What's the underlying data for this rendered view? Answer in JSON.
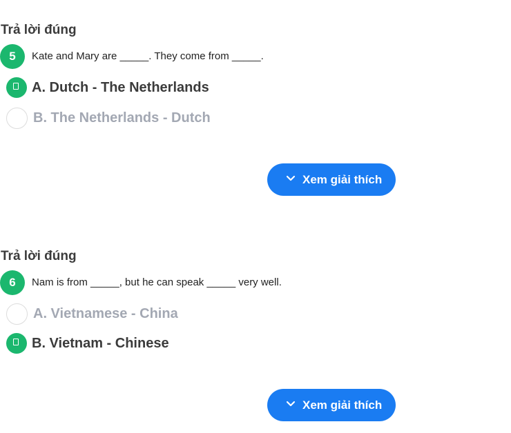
{
  "questions": [
    {
      "status": "Trả lời đúng",
      "number": "5",
      "text": "Kate and Mary are _____. They come from _____.",
      "options": [
        {
          "label": "A. Dutch - The Netherlands",
          "selected": true
        },
        {
          "label": "B. The Netherlands - Dutch",
          "selected": false
        }
      ],
      "explain_label": "Xem giải thích"
    },
    {
      "status": "Trả lời đúng",
      "number": "6",
      "text": "Nam is from _____, but he can speak _____ very well.",
      "options": [
        {
          "label": "A. Vietnamese - China",
          "selected": false
        },
        {
          "label": "B. Vietnam - Chinese",
          "selected": true
        }
      ],
      "explain_label": "Xem giải thích"
    }
  ],
  "colors": {
    "correct_green": "#1bb76e",
    "button_blue": "#1a7cf2",
    "muted_option": "#a3a8b3",
    "dark_text": "#3b3b3b"
  },
  "icons": {
    "selected_marker": "check-icon",
    "button_icon": "chevron-down-icon"
  }
}
